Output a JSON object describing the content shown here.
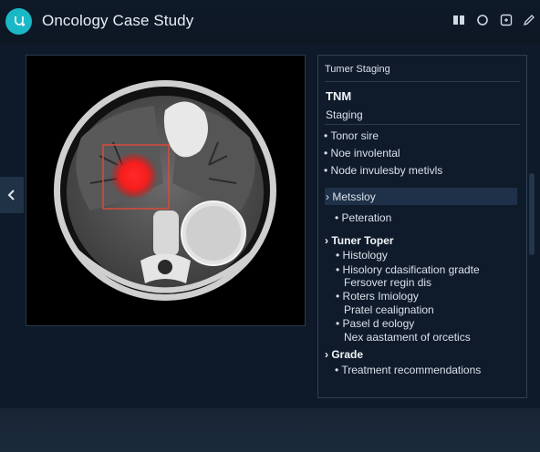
{
  "header": {
    "title": "Oncology Case Study",
    "logo_icon": "stethoscope-icon",
    "toolbar_icons": [
      "layers-icon",
      "circle-icon",
      "expand-icon",
      "pen-icon"
    ]
  },
  "viewer": {
    "image": "axial-ct-scan",
    "highlight_color": "#ff1f1f",
    "roi_color": "#d84b3a"
  },
  "panel": {
    "section_title": "Tumer Staging",
    "heading": "TNM",
    "subheading": "Staging",
    "items": [
      {
        "bullet": "•",
        "label": "Tonor sire"
      },
      {
        "bullet": "•",
        "label": "Noe involental"
      },
      {
        "bullet": "•",
        "label": "Node invulesby metivls"
      },
      {
        "bullet": "›",
        "label": "Metssloy"
      },
      {
        "bullet": "•",
        "label": "Peteration"
      },
      {
        "bullet": "›",
        "label": "Tuner Toper"
      },
      {
        "bullet": "•",
        "label": "Histology"
      },
      {
        "bullet": "•",
        "label": "Hisolory cdasification gradte"
      },
      {
        "bullet": "",
        "label": "Fersover regin dis"
      },
      {
        "bullet": "•",
        "label": "Roters Imiology"
      },
      {
        "bullet": "",
        "label": "Pratel cealignation"
      },
      {
        "bullet": "•",
        "label": "Pasel d eology"
      },
      {
        "bullet": "",
        "label": "Nex aastament of orcetics"
      },
      {
        "bullet": "›",
        "label": "Grade"
      },
      {
        "bullet": "•",
        "label": "Treatment recommendations"
      }
    ]
  },
  "accent": "#1ab8c6"
}
